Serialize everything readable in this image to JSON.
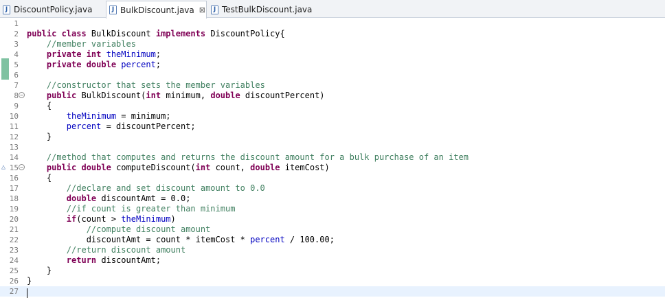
{
  "tabs": [
    {
      "label": "DiscountPolicy.java",
      "icon": "java-file-icon",
      "active": false
    },
    {
      "label": "BulkDiscount.java",
      "icon": "java-file-icon",
      "active": true,
      "close": "⊠"
    },
    {
      "label": "TestBulkDiscount.java",
      "icon": "java-file-icon",
      "active": false
    }
  ],
  "editor": {
    "current_line": 27,
    "lines": [
      {
        "n": "1",
        "t": []
      },
      {
        "n": "2",
        "t": [
          [
            "kw",
            "public class "
          ],
          [
            "",
            "BulkDiscount "
          ],
          [
            "kw",
            "implements "
          ],
          [
            "",
            "DiscountPolicy{"
          ]
        ]
      },
      {
        "n": "3",
        "t": [
          [
            "",
            "    "
          ],
          [
            "cm",
            "//member variables"
          ]
        ]
      },
      {
        "n": "4",
        "t": [
          [
            "",
            "    "
          ],
          [
            "kw",
            "private int "
          ],
          [
            "fd",
            "theMinimum"
          ],
          [
            "",
            ";"
          ]
        ]
      },
      {
        "n": "5",
        "t": [
          [
            "",
            "    "
          ],
          [
            "kw",
            "private double "
          ],
          [
            "fd",
            "percent"
          ],
          [
            "",
            ";"
          ]
        ]
      },
      {
        "n": "6",
        "t": []
      },
      {
        "n": "7",
        "t": [
          [
            "",
            "    "
          ],
          [
            "cm",
            "//constructor that sets the member variables"
          ]
        ]
      },
      {
        "n": "8",
        "fold": true,
        "t": [
          [
            "",
            "    "
          ],
          [
            "kw",
            "public "
          ],
          [
            "",
            "BulkDiscount("
          ],
          [
            "kw",
            "int "
          ],
          [
            "",
            "minimum, "
          ],
          [
            "kw",
            "double "
          ],
          [
            "",
            "discountPercent)"
          ]
        ]
      },
      {
        "n": "9",
        "t": [
          [
            "",
            "    {"
          ]
        ]
      },
      {
        "n": "10",
        "t": [
          [
            "",
            "        "
          ],
          [
            "fd",
            "theMinimum"
          ],
          [
            "",
            " = minimum;"
          ]
        ]
      },
      {
        "n": "11",
        "t": [
          [
            "",
            "        "
          ],
          [
            "fd",
            "percent"
          ],
          [
            "",
            " = discountPercent;"
          ]
        ]
      },
      {
        "n": "12",
        "t": [
          [
            "",
            "    }"
          ]
        ]
      },
      {
        "n": "13",
        "t": []
      },
      {
        "n": "14",
        "t": [
          [
            "",
            "    "
          ],
          [
            "cm",
            "//method that computes and returns the discount amount for a bulk purchase of an item"
          ]
        ]
      },
      {
        "n": "15",
        "fold": true,
        "override": true,
        "t": [
          [
            "",
            "    "
          ],
          [
            "kw",
            "public double "
          ],
          [
            "",
            "computeDiscount("
          ],
          [
            "kw",
            "int "
          ],
          [
            "",
            "count, "
          ],
          [
            "kw",
            "double "
          ],
          [
            "",
            "itemCost)"
          ]
        ]
      },
      {
        "n": "16",
        "t": [
          [
            "",
            "    {"
          ]
        ]
      },
      {
        "n": "17",
        "t": [
          [
            "",
            "        "
          ],
          [
            "cm",
            "//declare and set discount amount to 0.0"
          ]
        ]
      },
      {
        "n": "18",
        "t": [
          [
            "",
            "        "
          ],
          [
            "kw",
            "double "
          ],
          [
            "",
            "discountAmt = 0.0;"
          ]
        ]
      },
      {
        "n": "19",
        "t": [
          [
            "",
            "        "
          ],
          [
            "cm",
            "//if count is greater than minimum"
          ]
        ]
      },
      {
        "n": "20",
        "t": [
          [
            "",
            "        "
          ],
          [
            "kw",
            "if"
          ],
          [
            "",
            "(count > "
          ],
          [
            "fd",
            "theMinimum"
          ],
          [
            "",
            ")"
          ]
        ]
      },
      {
        "n": "21",
        "t": [
          [
            "",
            "            "
          ],
          [
            "cm",
            "//compute discount amount"
          ]
        ]
      },
      {
        "n": "22",
        "t": [
          [
            "",
            "            discountAmt = count * itemCost * "
          ],
          [
            "fd",
            "percent"
          ],
          [
            "",
            " / 100.00;"
          ]
        ]
      },
      {
        "n": "23",
        "t": [
          [
            "",
            "        "
          ],
          [
            "cm",
            "//return discount amount"
          ]
        ]
      },
      {
        "n": "24",
        "t": [
          [
            "",
            "        "
          ],
          [
            "kw",
            "return "
          ],
          [
            "",
            "discountAmt;"
          ]
        ]
      },
      {
        "n": "25",
        "t": [
          [
            "",
            "    }"
          ]
        ]
      },
      {
        "n": "26",
        "t": [
          [
            "",
            "}"
          ]
        ]
      },
      {
        "n": "27",
        "t": []
      }
    ]
  },
  "colors": {
    "keyword": "#7f0055",
    "comment": "#3f7f5f",
    "field": "#0000c0",
    "current_line": "#e8f2fe",
    "change_marker": "#7fc2a1"
  }
}
